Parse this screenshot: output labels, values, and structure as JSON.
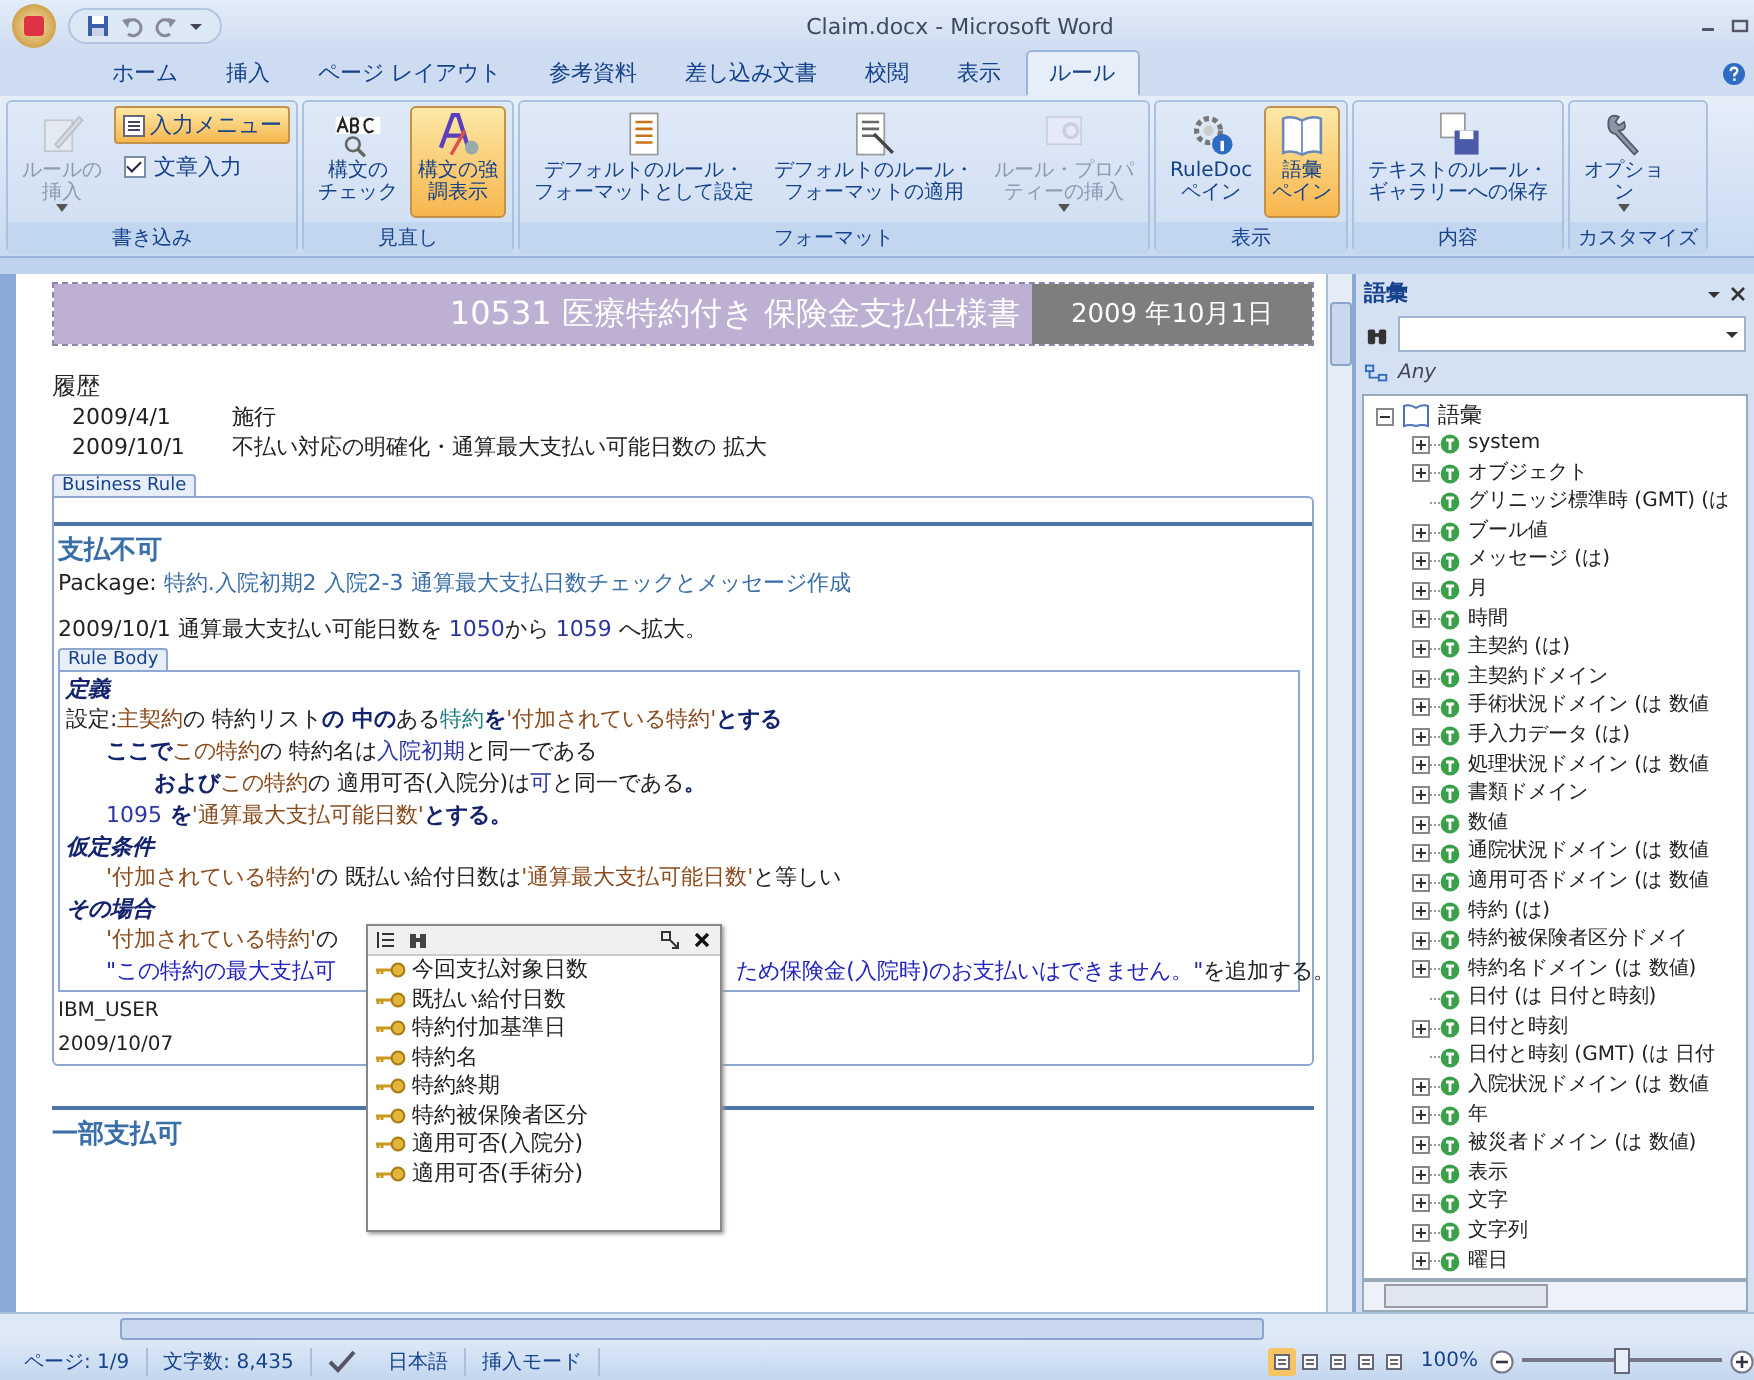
{
  "window": {
    "title": "Claim.docx - Microsoft Word"
  },
  "tabs": [
    {
      "label": "ホーム",
      "selected": false
    },
    {
      "label": "挿入",
      "selected": false
    },
    {
      "label": "ページ レイアウト",
      "selected": false
    },
    {
      "label": "参考資料",
      "selected": false
    },
    {
      "label": "差し込み文書",
      "selected": false
    },
    {
      "label": "校閲",
      "selected": false
    },
    {
      "label": "表示",
      "selected": false
    },
    {
      "label": "ルール",
      "selected": true
    }
  ],
  "ribbon": [
    {
      "label": "書き込み",
      "buttons": [
        {
          "kind": "large",
          "label": [
            "ルールの",
            "挿入"
          ],
          "has_menu": true,
          "selected": false,
          "disabled": true
        },
        {
          "kind": "small",
          "label": "入力メニュー",
          "selected": true,
          "disabled": false
        },
        {
          "kind": "check",
          "label": "文章入力",
          "checked": true
        }
      ]
    },
    {
      "label": "見直し",
      "buttons": [
        {
          "kind": "large",
          "label": [
            "構文の",
            "チェック"
          ],
          "has_menu": false,
          "selected": false,
          "disabled": false
        },
        {
          "kind": "large",
          "label": [
            "構文の強",
            "調表示"
          ],
          "has_menu": false,
          "selected": true,
          "disabled": false
        }
      ]
    },
    {
      "label": "フォーマット",
      "buttons": [
        {
          "kind": "large",
          "label": [
            "デフォルトのルール・",
            "フォーマットとして設定"
          ],
          "has_menu": false,
          "selected": false,
          "disabled": false
        },
        {
          "kind": "large",
          "label": [
            "デフォルトのルール・",
            "フォーマットの適用"
          ],
          "has_menu": false,
          "selected": false,
          "disabled": false
        },
        {
          "kind": "large",
          "label": [
            "ルール・プロパ",
            "ティーの挿入"
          ],
          "has_menu": true,
          "selected": false,
          "disabled": true
        }
      ]
    },
    {
      "label": "表示",
      "buttons": [
        {
          "kind": "large",
          "label": [
            "RuleDoc",
            "ペイン"
          ],
          "has_menu": false,
          "selected": false,
          "disabled": false
        },
        {
          "kind": "large",
          "label": [
            "語彙",
            "ペイン"
          ],
          "has_menu": false,
          "selected": true,
          "disabled": false
        }
      ]
    },
    {
      "label": "内容",
      "buttons": [
        {
          "kind": "large",
          "label": [
            "テキストのルール・",
            "ギャラリーへの保存"
          ],
          "has_menu": false,
          "selected": false,
          "disabled": false
        }
      ]
    },
    {
      "label": "カスタマイズ",
      "buttons": [
        {
          "kind": "large",
          "label": [
            "オプショ",
            "ン"
          ],
          "has_menu": true,
          "selected": false,
          "disabled": false
        }
      ]
    }
  ],
  "document": {
    "banner": {
      "title": "10531 医療特約付き 保険金支払仕様書",
      "date": "2009 年10月1日"
    },
    "history": {
      "heading": "履歴",
      "rows": [
        {
          "date": "2009/4/1",
          "text": "施行"
        },
        {
          "date": "2009/10/1",
          "text": "不払い対応の明確化・通算最大支払い可能日数の 拡大"
        }
      ]
    },
    "business_rule": {
      "tag": "Business Rule",
      "title": "支払不可",
      "package_label": "Package:",
      "package": "特約.入院初期2 入院2-3 通算最大支払日数チェックとメッセージ作成",
      "change_note": [
        {
          "kind": "plain",
          "text": "2009/10/1 通算最大支払い可能日数を "
        },
        {
          "kind": "value",
          "text": "1050"
        },
        {
          "kind": "plain",
          "text": "から "
        },
        {
          "kind": "value",
          "text": "1059"
        },
        {
          "kind": "plain",
          "text": " へ拡大。"
        }
      ],
      "body_tag": "Rule Body",
      "sections": [
        {
          "kind": "definition",
          "heading": "定義",
          "lines": [
            {
              "segments": [
                {
                  "kind": "plain",
                  "text": "設定:"
                },
                {
                  "kind": "term",
                  "text": "主契約"
                },
                {
                  "kind": "plain",
                  "text": "の 特約リスト"
                },
                {
                  "kind": "keyword",
                  "text": "の 中の"
                },
                {
                  "kind": "plain",
                  "text": "ある"
                },
                {
                  "kind": "concept",
                  "text": "特約"
                },
                {
                  "kind": "keyword",
                  "text": "を"
                },
                {
                  "kind": "term",
                  "text": "'付加されている特約'"
                },
                {
                  "kind": "keyword",
                  "text": "とする"
                }
              ],
              "children": [
                {
                  "segments": [
                    {
                      "kind": "keyword",
                      "text": "ここで"
                    },
                    {
                      "kind": "term",
                      "text": "この特約"
                    },
                    {
                      "kind": "plain",
                      "text": "の 特約名は"
                    },
                    {
                      "kind": "value",
                      "text": "入院初期"
                    },
                    {
                      "kind": "plain",
                      "text": "と同一である"
                    }
                  ],
                  "children": [
                    {
                      "segments": [
                        {
                          "kind": "keyword",
                          "text": "および"
                        },
                        {
                          "kind": "term",
                          "text": "この特約"
                        },
                        {
                          "kind": "plain",
                          "text": "の 適用可否(入院分)は"
                        },
                        {
                          "kind": "value",
                          "text": "可"
                        },
                        {
                          "kind": "plain",
                          "text": "と同一である"
                        },
                        {
                          "kind": "keyword",
                          "text": "。"
                        }
                      ]
                    }
                  ]
                },
                {
                  "segments": [
                    {
                      "kind": "value",
                      "text": "1095"
                    },
                    {
                      "kind": "keyword",
                      "text": " を"
                    },
                    {
                      "kind": "term",
                      "text": "'通算最大支払可能日数'"
                    },
                    {
                      "kind": "keyword",
                      "text": "とする。"
                    }
                  ]
                }
              ]
            }
          ]
        },
        {
          "kind": "condition",
          "heading": "仮定条件",
          "lines": [
            {
              "segments": [
                {
                  "kind": "term",
                  "text": "'付加されている特約'"
                },
                {
                  "kind": "plain",
                  "text": "の 既払い給付日数は"
                },
                {
                  "kind": "term",
                  "text": "'通算最大支払可能日数'"
                },
                {
                  "kind": "plain",
                  "text": "と等しい"
                }
              ]
            }
          ]
        },
        {
          "kind": "action",
          "heading": "その場合",
          "lines": [
            {
              "segments": [
                {
                  "kind": "term",
                  "text": "'付加されている特約'"
                },
                {
                  "kind": "plain",
                  "text": "の"
                }
              ]
            },
            {
              "segments": [
                {
                  "kind": "string",
                  "text": "\"この特約の最大支払可"
                }
              ],
              "after_popup": [
                {
                  "kind": "string",
                  "text": "ため保険金(入院時)のお支払いはできません。\""
                },
                {
                  "kind": "plain",
                  "text": "を追加する。"
                }
              ]
            }
          ]
        }
      ],
      "author": "IBM_USER",
      "date": "2009/10/07"
    },
    "next_rule": {
      "title": "一部支払可"
    }
  },
  "popup": {
    "items": [
      "今回支払対象日数",
      "既払い給付日数",
      "特約付加基準日",
      "特約名",
      "特約終期",
      "特約被保険者区分",
      "適用可否(入院分)",
      "適用可否(手術分)"
    ]
  },
  "vocabulary_pane": {
    "title": "語彙",
    "filter": "Any",
    "root": {
      "label": "語彙",
      "expanded": true,
      "children": [
        {
          "label": "system",
          "kind": "branch",
          "expanded": false
        },
        {
          "label": "オブジェクト",
          "kind": "branch",
          "expanded": false
        },
        {
          "label": "グリニッジ標準時 (GMT) (は",
          "kind": "leaf"
        },
        {
          "label": "ブール値",
          "kind": "branch",
          "expanded": false
        },
        {
          "label": "メッセージ (は)",
          "kind": "branch",
          "expanded": false
        },
        {
          "label": "月",
          "kind": "branch",
          "expanded": false
        },
        {
          "label": "時間",
          "kind": "branch",
          "expanded": false
        },
        {
          "label": "主契約 (は)",
          "kind": "branch",
          "expanded": false
        },
        {
          "label": "主契約ドメイン",
          "kind": "branch",
          "expanded": false
        },
        {
          "label": "手術状況ドメイン (は 数値",
          "kind": "branch",
          "expanded": false
        },
        {
          "label": "手入力データ (は)",
          "kind": "branch",
          "expanded": false
        },
        {
          "label": "処理状況ドメイン (は 数値",
          "kind": "branch",
          "expanded": false
        },
        {
          "label": "書類ドメイン",
          "kind": "branch",
          "expanded": false
        },
        {
          "label": "数値",
          "kind": "branch",
          "expanded": false
        },
        {
          "label": "通院状況ドメイン (は 数値",
          "kind": "branch",
          "expanded": false
        },
        {
          "label": "適用可否ドメイン (は 数値",
          "kind": "branch",
          "expanded": false
        },
        {
          "label": "特約 (は)",
          "kind": "branch",
          "expanded": false
        },
        {
          "label": "特約被保険者区分ドメイ",
          "kind": "branch",
          "expanded": false
        },
        {
          "label": "特約名ドメイン (は 数値)",
          "kind": "branch",
          "expanded": false
        },
        {
          "label": "日付 (は 日付と時刻)",
          "kind": "leaf"
        },
        {
          "label": "日付と時刻",
          "kind": "branch",
          "expanded": false
        },
        {
          "label": "日付と時刻 (GMT) (は 日付",
          "kind": "leaf"
        },
        {
          "label": "入院状況ドメイン (は 数値",
          "kind": "branch",
          "expanded": false
        },
        {
          "label": "年",
          "kind": "branch",
          "expanded": false
        },
        {
          "label": "被災者ドメイン (は 数値)",
          "kind": "branch",
          "expanded": false
        },
        {
          "label": "表示",
          "kind": "branch",
          "expanded": false
        },
        {
          "label": "文字",
          "kind": "branch",
          "expanded": false
        },
        {
          "label": "文字列",
          "kind": "branch",
          "expanded": false
        },
        {
          "label": "曜日",
          "kind": "branch",
          "expanded": false
        }
      ]
    }
  },
  "status_bar": {
    "page": "ページ: 1/9",
    "words": "文字数: 8,435",
    "language": "日本語",
    "mode": "挿入モード",
    "view_buttons": [
      {
        "selected": true
      },
      {
        "selected": false
      },
      {
        "selected": false
      },
      {
        "selected": false
      },
      {
        "selected": false
      }
    ],
    "zoom": "100%",
    "zoom_slider": {
      "level": 0.5
    }
  }
}
